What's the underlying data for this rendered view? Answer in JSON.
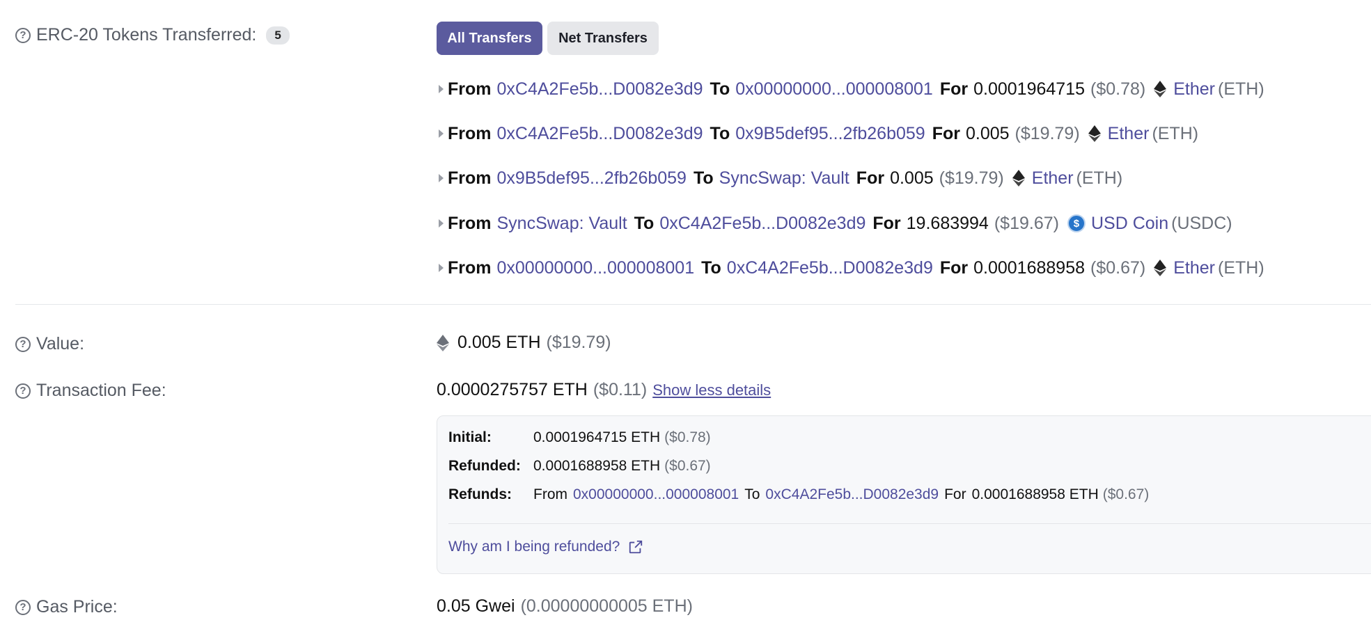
{
  "tokens_transferred": {
    "label": "ERC-20 Tokens Transferred:",
    "count": "5",
    "tabs": {
      "all": "All Transfers",
      "net": "Net Transfers"
    },
    "transfers": [
      {
        "from_kw": "From",
        "from": "0xC4A2Fe5b...D0082e3d9",
        "to_kw": "To",
        "to": "0x00000000...000008001",
        "for_kw": "For",
        "amount": "0.0001964715",
        "usd": "($0.78)",
        "token_icon": "ethereum-icon",
        "token": "Ether",
        "symbol": "(ETH)"
      },
      {
        "from_kw": "From",
        "from": "0xC4A2Fe5b...D0082e3d9",
        "to_kw": "To",
        "to": "0x9B5def95...2fb26b059",
        "for_kw": "For",
        "amount": "0.005",
        "usd": "($19.79)",
        "token_icon": "ethereum-icon",
        "token": "Ether",
        "symbol": "(ETH)"
      },
      {
        "from_kw": "From",
        "from": "0x9B5def95...2fb26b059",
        "to_kw": "To",
        "to": "SyncSwap: Vault",
        "for_kw": "For",
        "amount": "0.005",
        "usd": "($19.79)",
        "token_icon": "ethereum-icon",
        "token": "Ether",
        "symbol": "(ETH)"
      },
      {
        "from_kw": "From",
        "from": "SyncSwap: Vault",
        "to_kw": "To",
        "to": "0xC4A2Fe5b...D0082e3d9",
        "for_kw": "For",
        "amount": "19.683994",
        "usd": "($19.67)",
        "token_icon": "usdc-icon",
        "token": "USD Coin",
        "symbol": "(USDC)"
      },
      {
        "from_kw": "From",
        "from": "0x00000000...000008001",
        "to_kw": "To",
        "to": "0xC4A2Fe5b...D0082e3d9",
        "for_kw": "For",
        "amount": "0.0001688958",
        "usd": "($0.67)",
        "token_icon": "ethereum-icon",
        "token": "Ether",
        "symbol": "(ETH)"
      }
    ]
  },
  "value": {
    "label": "Value:",
    "amount": "0.005 ETH",
    "usd": "($19.79)"
  },
  "fee": {
    "label": "Transaction Fee:",
    "amount": "0.0000275757 ETH",
    "usd": "($0.11)",
    "toggle": "Show less details",
    "initial": {
      "label": "Initial:",
      "amount": "0.0001964715 ETH",
      "usd": "($0.78)"
    },
    "refunded": {
      "label": "Refunded:",
      "amount": "0.0001688958 ETH",
      "usd": "($0.67)"
    },
    "refunds": {
      "label": "Refunds:",
      "from_kw": "From",
      "from": "0x00000000...000008001",
      "to_kw": "To",
      "to": "0xC4A2Fe5b...D0082e3d9",
      "for_kw": "For",
      "amount": "0.0001688958 ETH",
      "usd": "($0.67)"
    },
    "why_link": "Why am I being refunded?"
  },
  "gas": {
    "label": "Gas Price:",
    "amount": "0.05 Gwei",
    "eth": "(0.00000000005 ETH)"
  },
  "colors": {
    "accent": "#5b5b9e",
    "link": "#4e4d9c",
    "muted": "#6b7079",
    "usdc": "#2775ca"
  }
}
